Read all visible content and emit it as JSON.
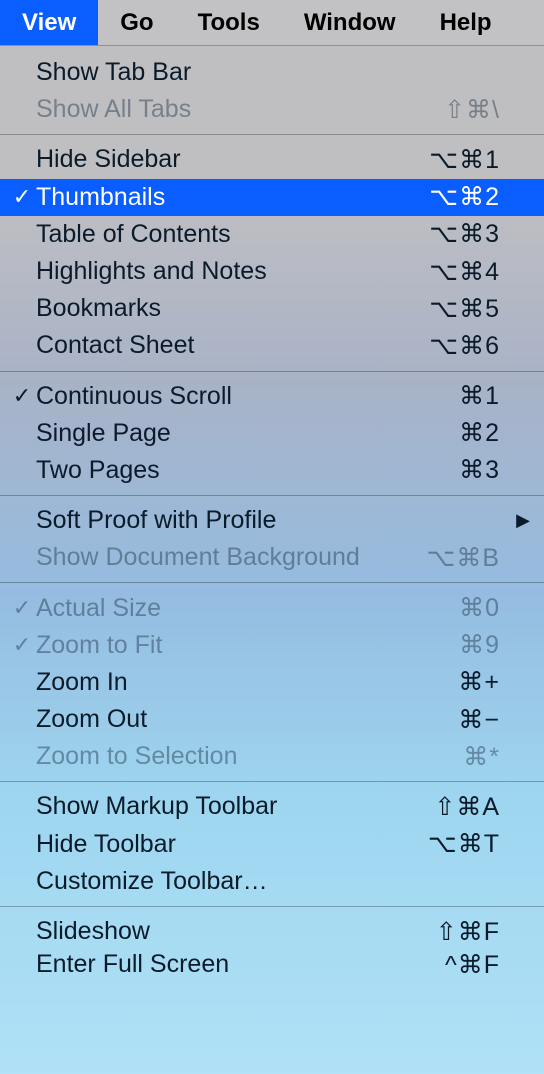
{
  "menubar": {
    "view": {
      "label": "View",
      "active": true
    },
    "go": {
      "label": "Go",
      "active": false
    },
    "tools": {
      "label": "Tools",
      "active": false
    },
    "window": {
      "label": "Window",
      "active": false
    },
    "help": {
      "label": "Help",
      "active": false
    }
  },
  "menu": {
    "show_tab_bar": {
      "label": "Show Tab Bar",
      "shortcut": "",
      "checked": false,
      "disabled": false,
      "highlighted": false,
      "submenu": false
    },
    "show_all_tabs": {
      "label": "Show All Tabs",
      "shortcut": "⇧⌘\\",
      "checked": false,
      "disabled": true,
      "highlighted": false,
      "submenu": false
    },
    "hide_sidebar": {
      "label": "Hide Sidebar",
      "shortcut": "⌥⌘1",
      "checked": false,
      "disabled": false,
      "highlighted": false,
      "submenu": false
    },
    "thumbnails": {
      "label": "Thumbnails",
      "shortcut": "⌥⌘2",
      "checked": true,
      "disabled": false,
      "highlighted": true,
      "submenu": false
    },
    "table_of_contents": {
      "label": "Table of Contents",
      "shortcut": "⌥⌘3",
      "checked": false,
      "disabled": false,
      "highlighted": false,
      "submenu": false
    },
    "highlights_notes": {
      "label": "Highlights and Notes",
      "shortcut": "⌥⌘4",
      "checked": false,
      "disabled": false,
      "highlighted": false,
      "submenu": false
    },
    "bookmarks": {
      "label": "Bookmarks",
      "shortcut": "⌥⌘5",
      "checked": false,
      "disabled": false,
      "highlighted": false,
      "submenu": false
    },
    "contact_sheet": {
      "label": "Contact Sheet",
      "shortcut": "⌥⌘6",
      "checked": false,
      "disabled": false,
      "highlighted": false,
      "submenu": false
    },
    "continuous_scroll": {
      "label": "Continuous Scroll",
      "shortcut": "⌘1",
      "checked": true,
      "disabled": false,
      "highlighted": false,
      "submenu": false
    },
    "single_page": {
      "label": "Single Page",
      "shortcut": "⌘2",
      "checked": false,
      "disabled": false,
      "highlighted": false,
      "submenu": false
    },
    "two_pages": {
      "label": "Two Pages",
      "shortcut": "⌘3",
      "checked": false,
      "disabled": false,
      "highlighted": false,
      "submenu": false
    },
    "soft_proof": {
      "label": "Soft Proof with Profile",
      "shortcut": "",
      "checked": false,
      "disabled": false,
      "highlighted": false,
      "submenu": true
    },
    "show_doc_bg": {
      "label": "Show Document Background",
      "shortcut": "⌥⌘B",
      "checked": false,
      "disabled": true,
      "highlighted": false,
      "submenu": false
    },
    "actual_size": {
      "label": "Actual Size",
      "shortcut": "⌘0",
      "checked": true,
      "disabled": true,
      "highlighted": false,
      "submenu": false
    },
    "zoom_to_fit": {
      "label": "Zoom to Fit",
      "shortcut": "⌘9",
      "checked": true,
      "disabled": true,
      "highlighted": false,
      "submenu": false
    },
    "zoom_in": {
      "label": "Zoom In",
      "shortcut": "⌘+",
      "checked": false,
      "disabled": false,
      "highlighted": false,
      "submenu": false
    },
    "zoom_out": {
      "label": "Zoom Out",
      "shortcut": "⌘−",
      "checked": false,
      "disabled": false,
      "highlighted": false,
      "submenu": false
    },
    "zoom_to_selection": {
      "label": "Zoom to Selection",
      "shortcut": "⌘*",
      "checked": false,
      "disabled": true,
      "highlighted": false,
      "submenu": false
    },
    "show_markup_toolbar": {
      "label": "Show Markup Toolbar",
      "shortcut": "⇧⌘A",
      "checked": false,
      "disabled": false,
      "highlighted": false,
      "submenu": false
    },
    "hide_toolbar": {
      "label": "Hide Toolbar",
      "shortcut": "⌥⌘T",
      "checked": false,
      "disabled": false,
      "highlighted": false,
      "submenu": false
    },
    "customize_toolbar": {
      "label": "Customize Toolbar…",
      "shortcut": "",
      "checked": false,
      "disabled": false,
      "highlighted": false,
      "submenu": false
    },
    "slideshow": {
      "label": "Slideshow",
      "shortcut": "⇧⌘F",
      "checked": false,
      "disabled": false,
      "highlighted": false,
      "submenu": false
    },
    "enter_full_screen": {
      "label": "Enter Full Screen",
      "shortcut": "^⌘F",
      "checked": false,
      "disabled": false,
      "highlighted": false,
      "submenu": false
    }
  },
  "glyphs": {
    "checkmark": "✓",
    "submenu_arrow": "▶"
  }
}
